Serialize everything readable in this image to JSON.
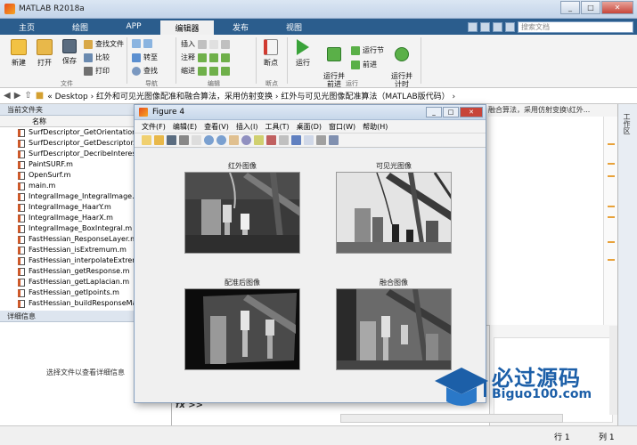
{
  "window": {
    "title": "MATLAB R2018a"
  },
  "tabs": [
    "主页",
    "绘图",
    "APP",
    "编辑器",
    "发布",
    "视图"
  ],
  "search": {
    "placeholder": "搜索文档"
  },
  "ribbon": {
    "new": "新建",
    "open": "打开",
    "save": "保存",
    "find_files": "查找文件",
    "compare": "比较",
    "print": "打印",
    "goto": "转至",
    "find": "查找",
    "insert": "插入",
    "comment": "注释",
    "indent": "缩进",
    "breakpoints": "断点",
    "run": "运行",
    "run_advance": "运行并\n前进",
    "run_section": "运行节",
    "advance": "前进",
    "run_time": "运行并\n计时",
    "groups": {
      "file": "文件",
      "nav": "导航",
      "edit": "编辑",
      "bp": "断点",
      "run": "运行"
    }
  },
  "address": {
    "path": "« Desktop › 红外和可见光图像配准和融合算法，采用仿射变换 › 红外与可见光图像配准算法（MATLAB版代码） ›"
  },
  "left_panel": {
    "header": "当前文件夹",
    "column": "名称",
    "files": [
      "SurfDescriptor_GetOrientation.m",
      "SurfDescriptor_GetDescriptor.m",
      "SurfDescriptor_DecribeInterestPoints.m",
      "PaintSURF.m",
      "OpenSurf.m",
      "main.m",
      "IntegralImage_IntegralImage.m",
      "IntegralImage_HaarY.m",
      "IntegralImage_HaarX.m",
      "IntegralImage_BoxIntegral.m",
      "FastHessian_ResponseLayer.m",
      "FastHessian_isExtremum.m",
      "FastHessian_interpolateExtremum.m",
      "FastHessian_getResponse.m",
      "FastHessian_getLaplacian.m",
      "FastHessian_getIpoints.m",
      "FastHessian_buildResponseMap.m"
    ],
    "details_header": "详细信息",
    "details_text": "选择文件以查看详细信息"
  },
  "editor": {
    "tab": "融合算法，采用仿射变换\\红外..."
  },
  "right_strip": {
    "label": "工作区"
  },
  "command": {
    "prompt": "fx >>"
  },
  "status": {
    "pos1": "行 1",
    "pos2": "列 1"
  },
  "figure": {
    "title": "Figure 4",
    "menu": [
      "文件(F)",
      "编辑(E)",
      "查看(V)",
      "插入(I)",
      "工具(T)",
      "桌面(D)",
      "窗口(W)",
      "帮助(H)"
    ],
    "subplots": [
      "红外图像",
      "可见光图像",
      "配准后图像",
      "融合图像"
    ]
  },
  "watermark": {
    "text": "必过源码",
    "url": "Biguo100.com"
  }
}
